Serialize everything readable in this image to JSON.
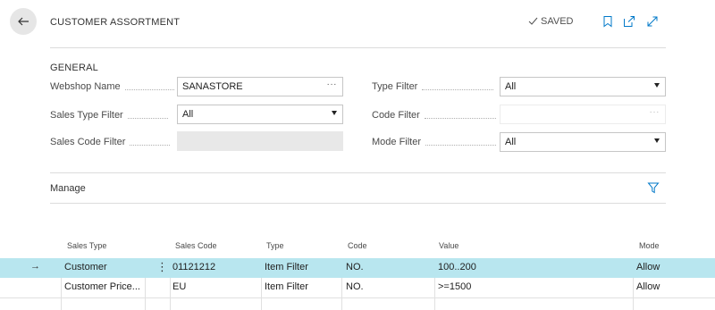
{
  "header": {
    "title": "CUSTOMER ASSORTMENT",
    "saved_label": "SAVED"
  },
  "general": {
    "section_title": "GENERAL",
    "fields": {
      "webshop_name": {
        "label": "Webshop Name",
        "value": "SANASTORE"
      },
      "sales_type_filter": {
        "label": "Sales Type Filter",
        "value": "All"
      },
      "sales_code_filter": {
        "label": "Sales Code Filter",
        "value": ""
      },
      "type_filter": {
        "label": "Type Filter",
        "value": "All"
      },
      "code_filter": {
        "label": "Code Filter",
        "value": ""
      },
      "mode_filter": {
        "label": "Mode Filter",
        "value": "All"
      }
    }
  },
  "manage": {
    "label": "Manage"
  },
  "table": {
    "columns": [
      "Sales Type",
      "Sales Code",
      "Type",
      "Code",
      "Value",
      "Mode"
    ],
    "rows": [
      {
        "sales_type": "Customer",
        "sales_code": "01121212",
        "type": "Item Filter",
        "code": "NO.",
        "value": "100..200",
        "mode": "Allow",
        "selected": true
      },
      {
        "sales_type": "Customer Price...",
        "sales_code": "EU",
        "type": "Item Filter",
        "code": "NO.",
        "value": ">=1500",
        "mode": "Allow",
        "selected": false
      }
    ]
  },
  "icons": {
    "back": "arrow-left-icon",
    "saved_check": "check-icon",
    "bookmark": "bookmark-icon",
    "open_new": "open-in-new-window-icon",
    "expand": "expand-icon",
    "filter": "filter-funnel-icon",
    "row_pointer": "row-pointer-arrow-icon",
    "row_menu": "more-vertical-icon"
  },
  "colors": {
    "accent": "#0078c8",
    "selected_row": "#b8e6ef",
    "back_button_bg": "#e6e6e6"
  }
}
